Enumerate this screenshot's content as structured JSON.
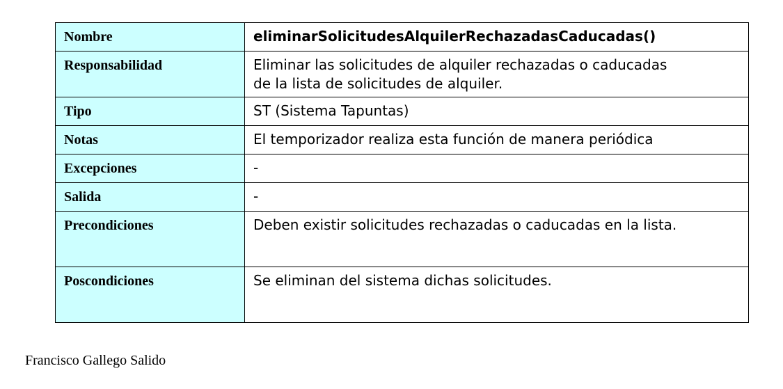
{
  "table": {
    "rows": [
      {
        "label": "Nombre",
        "value": "eliminarSolicitudesAlquilerRechazadasCaducadas()"
      },
      {
        "label": "Responsabilidad",
        "value_line1": "Eliminar las solicitudes de alquiler rechazadas o caducadas",
        "value_line2": "de la lista de solicitudes de alquiler."
      },
      {
        "label": "Tipo",
        "value": "ST (Sistema Tapuntas)"
      },
      {
        "label": "Notas",
        "value": "El temporizador realiza esta función de manera periódica"
      },
      {
        "label": "Excepciones",
        "value": "-"
      },
      {
        "label": "Salida",
        "value": "-"
      },
      {
        "label": "Precondiciones",
        "value": "Deben existir solicitudes rechazadas o caducadas en la lista."
      },
      {
        "label": "Poscondiciones",
        "value": "Se eliminan del sistema dichas solicitudes."
      }
    ]
  },
  "footer": {
    "author": "Francisco Gallego Salido"
  },
  "colors": {
    "label_background": "#ccffff",
    "border": "#000000"
  }
}
